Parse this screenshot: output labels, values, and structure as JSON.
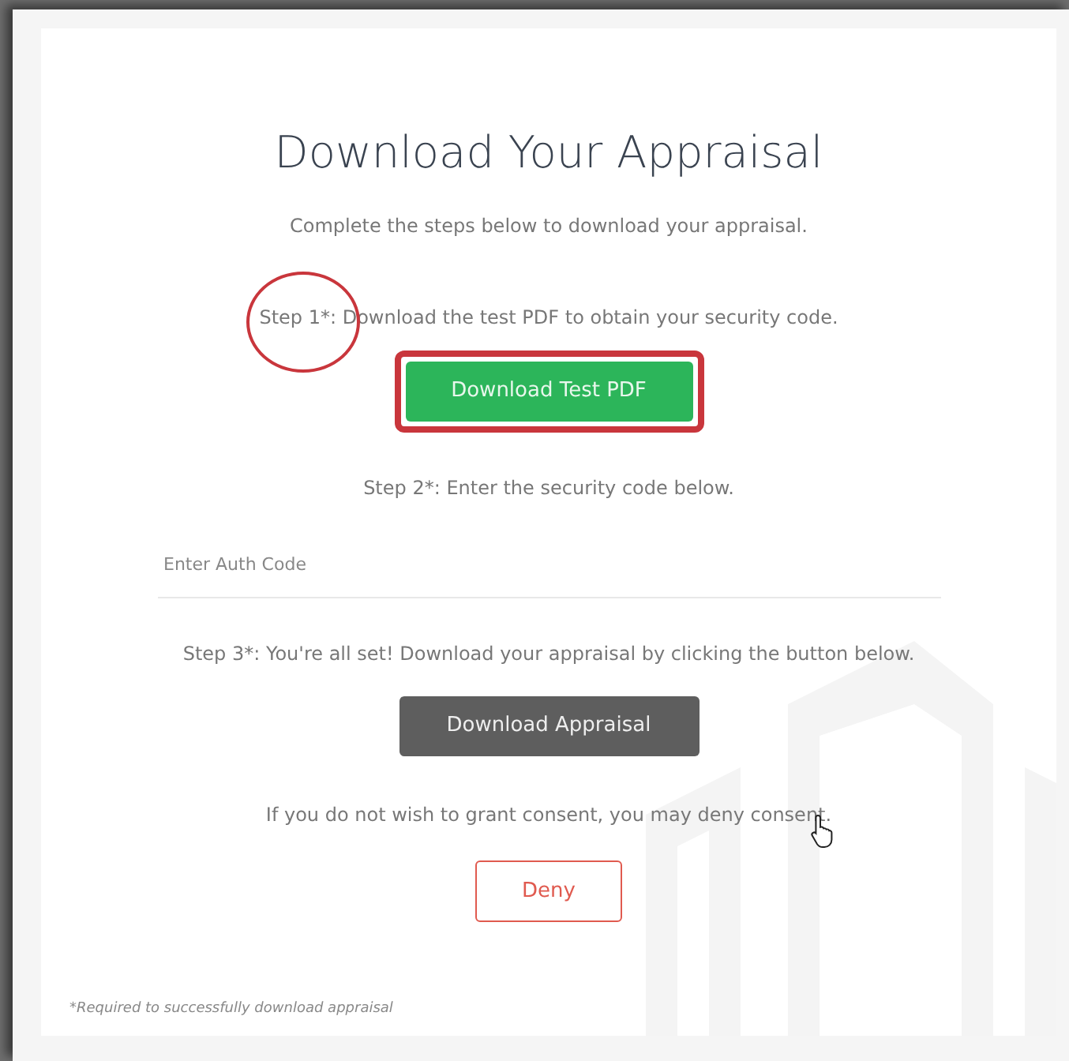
{
  "title": "Download Your Appraisal",
  "subtitle": "Complete the steps below to download your appraisal.",
  "steps": [
    {
      "kind": "button",
      "label": "Step 1*",
      "text": ": Download the test PDF to obtain your security code.",
      "button": {
        "label": "Download Test PDF",
        "highlighted": true
      },
      "label_circled": true
    },
    {
      "kind": "field",
      "label": "Step 2*",
      "text": ": Enter the security code below.",
      "field": {
        "placeholder": "Enter Auth Code"
      }
    },
    {
      "kind": "button",
      "label": "Step 3*",
      "text": ": You're all set! Download your appraisal by clicking the button below.",
      "button": {
        "label": "Download Appraisal"
      }
    }
  ],
  "consent": {
    "text": "If you do not wish to grant consent, you may deny consent.",
    "button": {
      "label": "Deny"
    },
    "pointer_visible": true
  },
  "footnote": "*Required to successfully download appraisal"
}
